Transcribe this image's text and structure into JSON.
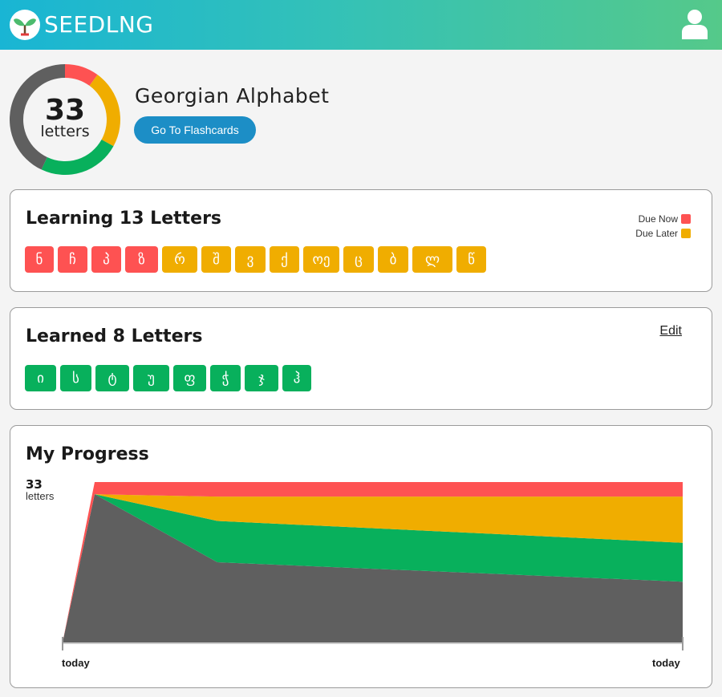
{
  "header": {
    "brand": "SEEDLNG",
    "logo_icon": "seedling-icon",
    "avatar_icon": "user-icon"
  },
  "deck": {
    "count": "33",
    "count_unit": "letters",
    "title": "Georgian Alphabet",
    "flashcards_button": "Go To Flashcards",
    "ring_segments": [
      {
        "name": "due-now",
        "color": "#fe5252",
        "fraction": 0.1
      },
      {
        "name": "due-later",
        "color": "#f0ad00",
        "fraction": 0.23
      },
      {
        "name": "learned",
        "color": "#08b05c",
        "fraction": 0.24
      },
      {
        "name": "unseen",
        "color": "#5f5f5f",
        "fraction": 0.43
      }
    ]
  },
  "learning": {
    "title": "Learning 13 Letters",
    "legend": [
      {
        "label": "Due Now",
        "color": "#fe5252"
      },
      {
        "label": "Due Later",
        "color": "#f0ad00"
      }
    ],
    "letters": [
      {
        "char": "ნ",
        "status": "now"
      },
      {
        "char": "ჩ",
        "status": "now"
      },
      {
        "char": "პ",
        "status": "now"
      },
      {
        "char": "ზ",
        "status": "now"
      },
      {
        "char": "რ",
        "status": "later"
      },
      {
        "char": "შ",
        "status": "later"
      },
      {
        "char": "ვ",
        "status": "later"
      },
      {
        "char": "ქ",
        "status": "later"
      },
      {
        "char": "ოე",
        "status": "later"
      },
      {
        "char": "ც",
        "status": "later"
      },
      {
        "char": "ბ",
        "status": "later"
      },
      {
        "char": "ლ",
        "status": "later"
      },
      {
        "char": "წ",
        "status": "later"
      }
    ]
  },
  "learned": {
    "title": "Learned 8 Letters",
    "edit_label": "Edit",
    "letters": [
      "ი",
      "ს",
      "ტ",
      "უ",
      "ფ",
      "ჭ",
      "ჯ",
      "ჰ"
    ]
  },
  "progress": {
    "title": "My Progress",
    "count": "33",
    "count_unit": "letters",
    "x_start_label": "today",
    "x_end_label": "today"
  },
  "colors": {
    "due_now": "#fe5252",
    "due_later": "#f0ad00",
    "learned": "#08b05c",
    "unseen": "#5f5f5f",
    "button": "#1c8ec6"
  },
  "chart_data": {
    "type": "area",
    "x": [
      0,
      1,
      2,
      3
    ],
    "x_tick_labels": [
      "today",
      "today"
    ],
    "ylim": [
      0,
      33
    ],
    "y_max_label": "33",
    "y_unit": "letters",
    "stacked": true,
    "series": [
      {
        "key": "unseen",
        "color": "#5f5f5f",
        "values": [
          0,
          30.5,
          16.5,
          12.5
        ]
      },
      {
        "key": "learned",
        "color": "#08b05c",
        "values": [
          0,
          0,
          8.5,
          8
        ]
      },
      {
        "key": "due_later",
        "color": "#f0ad00",
        "values": [
          0,
          0,
          5,
          9.5
        ]
      },
      {
        "key": "due_now",
        "color": "#fe5252",
        "values": [
          0,
          2.5,
          3,
          3
        ]
      }
    ]
  }
}
